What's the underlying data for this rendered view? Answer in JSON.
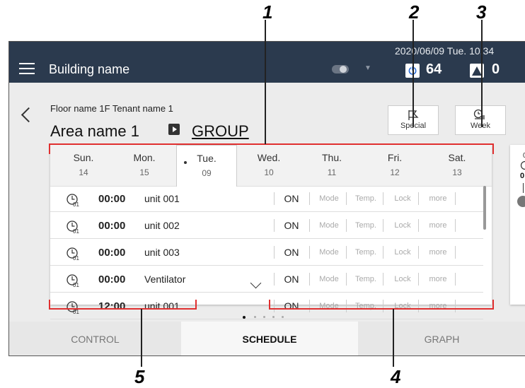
{
  "callouts": [
    "1",
    "2",
    "3",
    "4",
    "5"
  ],
  "header": {
    "menu_icon": "hamburger-icon",
    "building_name": "Building name",
    "datetime": "2020/06/09 Tue. 10:34",
    "count_on": "64",
    "count_alert": "0",
    "accent": "#2b3a4e"
  },
  "area": {
    "floor_tenant": "Floor name 1F Tenant name 1",
    "area_name": "Area name 1",
    "group_link": "GROUP"
  },
  "buttons": {
    "special": "Special",
    "week": "Week"
  },
  "days": [
    {
      "name": "Sun.",
      "date": "14"
    },
    {
      "name": "Mon.",
      "date": "15"
    },
    {
      "name": "Tue.",
      "date": "09"
    },
    {
      "name": "Wed.",
      "date": "10"
    },
    {
      "name": "Thu.",
      "date": "11"
    },
    {
      "name": "Fri.",
      "date": "12"
    },
    {
      "name": "Sat.",
      "date": "13"
    }
  ],
  "schedule_rows": [
    {
      "sub": "01",
      "time": "00:00",
      "unit": "unit 001",
      "state": "ON"
    },
    {
      "sub": "01",
      "time": "00:00",
      "unit": "unit 002",
      "state": "ON"
    },
    {
      "sub": "01",
      "time": "00:00",
      "unit": "unit 003",
      "state": "ON"
    },
    {
      "sub": "01",
      "time": "00:00",
      "unit": "Ventilator",
      "state": "ON"
    },
    {
      "sub": "01",
      "time": "12:00",
      "unit": "unit 001",
      "state": "ON"
    }
  ],
  "options": [
    "Mode",
    "Temp.",
    "Lock",
    "more"
  ],
  "sidecard": {
    "time": "0",
    "bold": "0"
  },
  "tabs": [
    "CONTROL",
    "SCHEDULE",
    "GRAPH"
  ]
}
